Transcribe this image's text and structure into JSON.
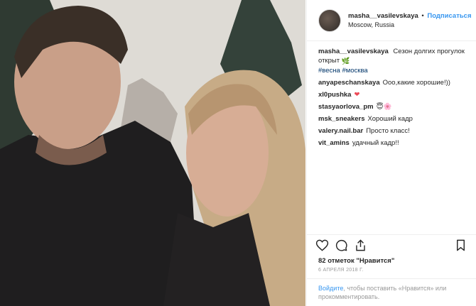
{
  "post": {
    "username": "masha__vasilevskaya",
    "dot": "•",
    "follow_label": "Подписаться",
    "location": "Moscow, Russia"
  },
  "caption": {
    "username": "masha__vasilevskaya",
    "text": "Сезон долгих прогулок открыт",
    "emoji": "🌿",
    "hashtags": [
      "#весна",
      "#москва"
    ]
  },
  "comments": [
    {
      "user": "anyapeschanskaya",
      "text": "Ооо,какие хорошие!))"
    },
    {
      "user": "xl0pushka",
      "text": "❤"
    },
    {
      "user": "stasyaorlova_pm",
      "text": "😇🌸"
    },
    {
      "user": "msk_sneakers",
      "text": "Хороший кадр"
    },
    {
      "user": "valery.nail.bar",
      "text": "Просто класс!"
    },
    {
      "user": "vit_amins",
      "text": "удачный кадр!!"
    }
  ],
  "likes_text": "82 отметок \"Нравится\"",
  "date_text": "6 АПРЕЛЯ 2018 Г.",
  "footer": {
    "login_link": "Войдите",
    "text": ", чтобы поставить «Нравится» или прокомментировать."
  },
  "colors": {
    "link": "#3897f0",
    "hashtag": "#003569",
    "heart": "#ed4956"
  }
}
